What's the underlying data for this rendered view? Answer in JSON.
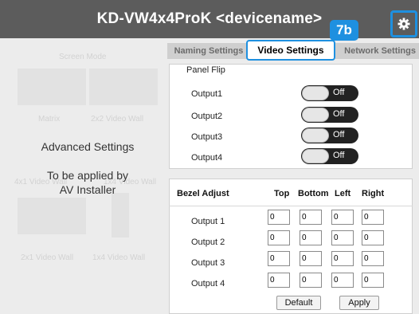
{
  "window": {
    "title": "KD-VW4x4ProK <devicename>"
  },
  "callout": {
    "label": "7b"
  },
  "left_panel": {
    "ghost_labels": [
      "Screen Mode",
      "Matrix",
      "2x2 Video Wall",
      "4x1 Video Wall",
      "1x4 Video Wall",
      "2x1 Video Wall",
      "1x4 Video Wall"
    ],
    "overlay_line1": "Advanced Settings",
    "overlay_line2": "To be applied by",
    "overlay_line3": "AV Installer"
  },
  "tabs": [
    {
      "label": "Naming Settings"
    },
    {
      "label": "Video Settings"
    },
    {
      "label": "Network Settings"
    }
  ],
  "panel_flip": {
    "title": "Panel Flip",
    "outputs": [
      {
        "label": "Output1",
        "state": "Off"
      },
      {
        "label": "Output2",
        "state": "Off"
      },
      {
        "label": "Output3",
        "state": "Off"
      },
      {
        "label": "Output4",
        "state": "Off"
      }
    ]
  },
  "bezel": {
    "title": "Bezel Adjust",
    "columns": [
      "Top",
      "Bottom",
      "Left",
      "Right"
    ],
    "rows": [
      {
        "label": "Output 1",
        "values": [
          "0",
          "0",
          "0",
          "0"
        ]
      },
      {
        "label": "Output 2",
        "values": [
          "0",
          "0",
          "0",
          "0"
        ]
      },
      {
        "label": "Output 3",
        "values": [
          "0",
          "0",
          "0",
          "0"
        ]
      },
      {
        "label": "Output 4",
        "values": [
          "0",
          "0",
          "0",
          "0"
        ]
      }
    ],
    "default_label": "Default",
    "apply_label": "Apply"
  },
  "colors": {
    "accent": "#1e90e0",
    "titlebar": "#5c5c5c"
  },
  "icons": {
    "settings": "gear-icon"
  }
}
